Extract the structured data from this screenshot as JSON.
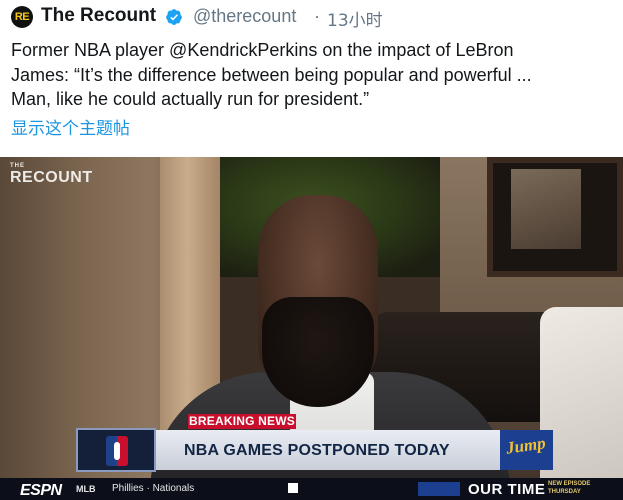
{
  "header": {
    "avatar_text": "RE",
    "display_name": "The Recount",
    "verified_icon": "verified-badge-icon",
    "handle": "@therecount",
    "separator": "·",
    "time": "13小时"
  },
  "tweet": {
    "lines": [
      "Former NBA player @KendrickPerkins on the impact of LeBron",
      "James: “It’s the difference between being popular and powerful ...",
      "Man, like he could actually run for president.”"
    ],
    "show_thread": "显示这个主题帖"
  },
  "video": {
    "watermark": "RECOUNT",
    "watermark_sub": "THE",
    "breaking_label": "BREAKING NEWS",
    "headline": "NBA GAMES POSTPONED TODAY",
    "show_logo": "Jump",
    "ticker": {
      "network": "ESPN",
      "league": "MLB",
      "teams": "Phillies  ·  Nationals",
      "our_time": "OUR TIME",
      "promo": "NEW EPISODE THURSDAY"
    }
  },
  "colors": {
    "accent": "#1b95e0",
    "breaking_red": "#c8102e",
    "verified_blue": "#1da1f2"
  }
}
